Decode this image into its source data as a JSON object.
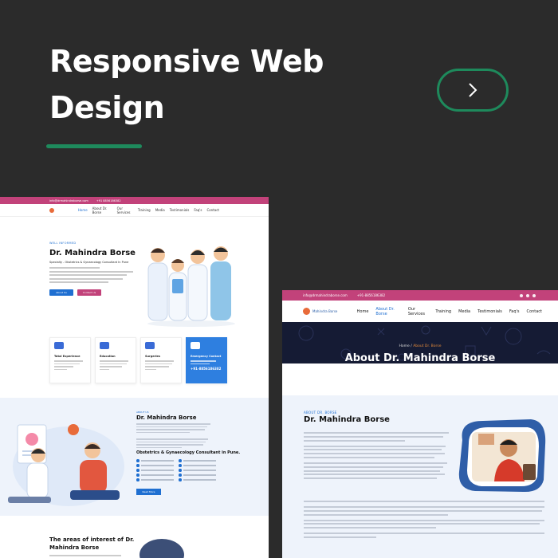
{
  "hero": {
    "title": "Responsive Web Design",
    "next_icon": "chevron-right-icon",
    "accent_color": "#1e8a5c"
  },
  "mockup_desktop": {
    "topbar": {
      "email": "info@drmahindraborse.com",
      "phone": "+91 8856186382"
    },
    "nav": [
      "Home",
      "About Dr. Borse",
      "Our Services",
      "Training",
      "Media",
      "Testimonials",
      "Faq's",
      "Contact"
    ],
    "hero": {
      "eyebrow": "WELL INFORMED",
      "name": "Dr. Mahindra Borse",
      "specialty": "Specialty - Obstetrics & Gynaecology Consultant In Pune",
      "btn_primary": "About Us",
      "btn_secondary": "Contact Us"
    },
    "cards": [
      {
        "title": "Total Experience"
      },
      {
        "title": "Education"
      },
      {
        "title": "Surgeries"
      },
      {
        "title": "Emergency Contact",
        "phone": "+91-8856186382"
      }
    ],
    "about": {
      "eyebrow": "ABOUT US",
      "name": "Dr. Mahindra Borse",
      "subtitle": "Obstetrics & Gynaecology Consultant in Pune.",
      "button": "Read More"
    },
    "areas_title": "The areas of interest of Dr. Mahindra Borse"
  },
  "mockup_about_page": {
    "topbar": {
      "email": "info@drmahindraborse.com",
      "phone": "+91-8856186382"
    },
    "logo_text": "Mahindra Borse",
    "nav": [
      "Home",
      "About Dr. Borse",
      "Our Services",
      "Training",
      "Media",
      "Testimonials",
      "Faq's",
      "Contact"
    ],
    "active_nav": "About Dr. Borse",
    "breadcrumb": {
      "home": "Home",
      "separator": "/",
      "current": "About Dr. Borse"
    },
    "page_title": "About Dr. Mahindra Borse",
    "section_eyebrow": "ABOUT DR. BORSE",
    "section_name": "Dr. Mahindra Borse",
    "brand_colors": {
      "pink": "#c2427a",
      "blue": "#1f6fd1",
      "navy": "#151b34"
    }
  }
}
